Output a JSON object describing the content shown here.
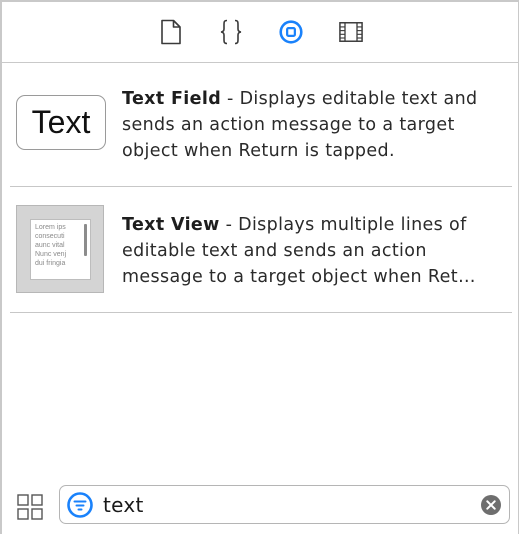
{
  "tabs": [
    {
      "name": "file-inspector",
      "icon": "document-icon",
      "selected": false
    },
    {
      "name": "quick-help",
      "icon": "braces-icon",
      "selected": false
    },
    {
      "name": "object-library",
      "icon": "object-library-icon",
      "selected": true
    },
    {
      "name": "media-library",
      "icon": "film-strip-icon",
      "selected": false
    }
  ],
  "items": [
    {
      "thumb_text": "Text",
      "title": "Text Field",
      "description": " - Displays editable text and sends an action message to a target object when Return is tapped."
    },
    {
      "thumb_lines": [
        "Lorem ips",
        "consecuti",
        "aunc vital",
        "Nunc venj",
        "dui fringia"
      ],
      "title": "Text View",
      "description": " - Displays multiple lines of editable text and sends an action message to a target object when Ret…"
    }
  ],
  "search": {
    "value": "text"
  },
  "colors": {
    "accent": "#1a82fb",
    "separator": "#c7c7c7",
    "icon_gray": "#3a3a3a"
  }
}
